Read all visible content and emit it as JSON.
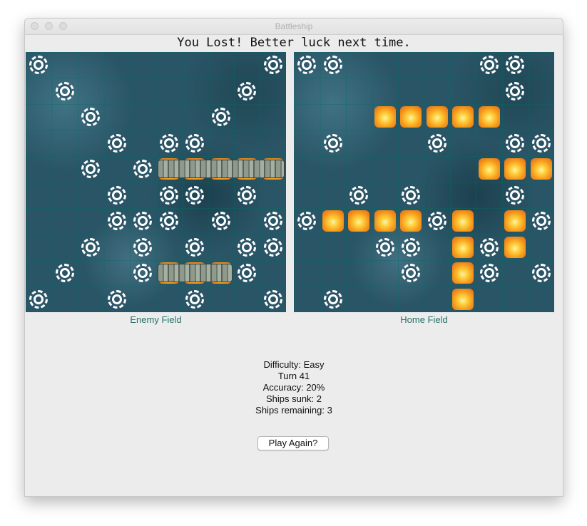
{
  "window": {
    "title": "Battleship"
  },
  "result_message": "You Lost! Better luck next time.",
  "boards": {
    "enemy": {
      "label": "Enemy Field",
      "misses": [
        [
          0,
          0
        ],
        [
          0,
          9
        ],
        [
          1,
          1
        ],
        [
          1,
          8
        ],
        [
          2,
          2
        ],
        [
          2,
          7
        ],
        [
          3,
          3
        ],
        [
          3,
          5
        ],
        [
          3,
          6
        ],
        [
          4,
          2
        ],
        [
          4,
          4
        ],
        [
          5,
          3
        ],
        [
          5,
          5
        ],
        [
          5,
          6
        ],
        [
          5,
          8
        ],
        [
          6,
          3
        ],
        [
          6,
          4
        ],
        [
          6,
          5
        ],
        [
          6,
          7
        ],
        [
          6,
          9
        ],
        [
          7,
          2
        ],
        [
          7,
          4
        ],
        [
          7,
          6
        ],
        [
          7,
          8
        ],
        [
          7,
          9
        ],
        [
          8,
          1
        ],
        [
          8,
          4
        ],
        [
          8,
          8
        ],
        [
          9,
          0
        ],
        [
          9,
          3
        ],
        [
          9,
          6
        ],
        [
          9,
          9
        ]
      ],
      "hits": [
        [
          4,
          5
        ],
        [
          4,
          6
        ],
        [
          4,
          7
        ],
        [
          4,
          8
        ],
        [
          4,
          9
        ],
        [
          8,
          5
        ],
        [
          8,
          6
        ],
        [
          8,
          7
        ]
      ],
      "ships": [
        {
          "row": 4,
          "col": 5,
          "length": 5
        },
        {
          "row": 8,
          "col": 5,
          "length": 3
        }
      ]
    },
    "home": {
      "label": "Home Field",
      "misses": [
        [
          0,
          0
        ],
        [
          0,
          1
        ],
        [
          0,
          7
        ],
        [
          0,
          8
        ],
        [
          1,
          8
        ],
        [
          3,
          1
        ],
        [
          3,
          5
        ],
        [
          3,
          8
        ],
        [
          3,
          9
        ],
        [
          5,
          2
        ],
        [
          5,
          4
        ],
        [
          5,
          8
        ],
        [
          6,
          0
        ],
        [
          6,
          5
        ],
        [
          6,
          9
        ],
        [
          7,
          3
        ],
        [
          7,
          4
        ],
        [
          7,
          7
        ],
        [
          8,
          4
        ],
        [
          8,
          7
        ],
        [
          8,
          9
        ],
        [
          9,
          1
        ]
      ],
      "hits": [
        [
          2,
          3
        ],
        [
          2,
          4
        ],
        [
          2,
          5
        ],
        [
          2,
          6
        ],
        [
          2,
          7
        ],
        [
          4,
          7
        ],
        [
          4,
          8
        ],
        [
          4,
          9
        ],
        [
          6,
          1
        ],
        [
          6,
          2
        ],
        [
          6,
          3
        ],
        [
          6,
          4
        ],
        [
          6,
          6
        ],
        [
          6,
          8
        ],
        [
          7,
          6
        ],
        [
          7,
          8
        ],
        [
          8,
          6
        ],
        [
          9,
          6
        ]
      ],
      "ships": []
    }
  },
  "stats": {
    "difficulty": "Difficulty: Easy",
    "turn": "Turn 41",
    "accuracy": "Accuracy: 20%",
    "ships_sunk": "Ships sunk: 2",
    "ships_remaining": "Ships remaining: 3"
  },
  "play_again_label": "Play Again?"
}
